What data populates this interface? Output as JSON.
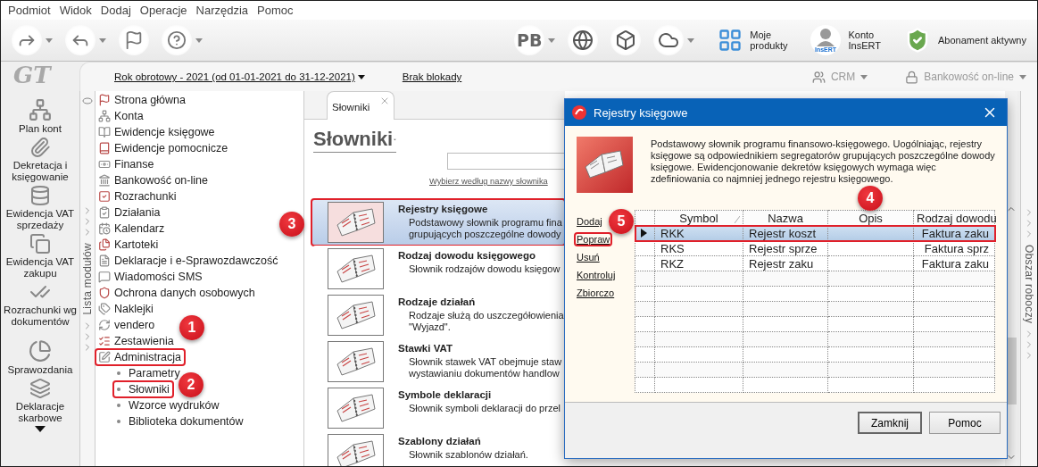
{
  "menu": [
    "Podmiot",
    "Widok",
    "Dodaj",
    "Operacje",
    "Narzędzia",
    "Pomoc"
  ],
  "toolbar": {
    "left_buttons": [
      {
        "kind": "send",
        "dropdown": true
      },
      {
        "kind": "receive",
        "dropdown": true
      },
      {
        "kind": "flag",
        "dropdown": false
      },
      {
        "kind": "help",
        "dropdown": true
      }
    ],
    "right_buttons": [
      {
        "kind": "initials",
        "label": "PB",
        "dropdown": true
      },
      {
        "kind": "globe",
        "dropdown": false
      },
      {
        "kind": "cube",
        "dropdown": false
      },
      {
        "kind": "cloud",
        "dropdown": true
      }
    ],
    "links": [
      {
        "kind": "products",
        "label": "Moje\nprodukty"
      },
      {
        "kind": "account",
        "label": "Konto\nInsERT",
        "icon_text": "InsERT"
      },
      {
        "kind": "subscription",
        "label": "Abonament aktywny"
      }
    ]
  },
  "logo": "GT",
  "shortcuts": [
    "Plan kont",
    "Dekretacja i księgowanie",
    "Ewidencja VAT sprzedaży",
    "Ewidencja VAT zakupu",
    "Rozrachunki wg dokumentów",
    "Sprawozdania",
    "Deklaracje skarbowe"
  ],
  "period_bar": {
    "period": "Rok obrotowy - 2021  (od 01-01-2021 do 31-12-2021)",
    "lock": "Brak blokady",
    "tools": [
      {
        "kind": "crm",
        "label": "CRM"
      },
      {
        "kind": "bank",
        "label": "Bankowość on-line"
      }
    ]
  },
  "modules": {
    "label": "Lista modułów",
    "items": [
      {
        "label": "Strona główna",
        "outlined": false
      },
      {
        "label": "Konta",
        "outlined": false
      },
      {
        "label": "Ewidencje księgowe",
        "outlined": false
      },
      {
        "label": "Ewidencje pomocnicze",
        "outlined": false
      },
      {
        "label": "Finanse",
        "outlined": false
      },
      {
        "label": "Bankowość on-line",
        "outlined": false
      },
      {
        "label": "Rozrachunki",
        "outlined": false
      },
      {
        "label": "Działania",
        "outlined": false
      },
      {
        "label": "Kalendarz",
        "outlined": false
      },
      {
        "label": "Kartoteki",
        "outlined": false
      },
      {
        "label": "Deklaracje i e-Sprawozdawczość",
        "outlined": false
      },
      {
        "label": "Wiadomości SMS",
        "outlined": false
      },
      {
        "label": "Ochrona danych osobowych",
        "outlined": false
      },
      {
        "label": "Naklejki",
        "outlined": false
      },
      {
        "label": "vendero",
        "outlined": false
      },
      {
        "label": "Zestawienia",
        "outlined": false
      },
      {
        "label": "Administracja",
        "outlined": true,
        "children": [
          {
            "label": "Parametry",
            "outlined": false
          },
          {
            "label": "Słowniki",
            "outlined": true
          },
          {
            "label": "Wzorce wydruków",
            "outlined": false
          },
          {
            "label": "Biblioteka dokumentów",
            "outlined": false
          }
        ]
      }
    ]
  },
  "content": {
    "tab": {
      "label": "Słowniki"
    },
    "heading": "Słowniki",
    "filter_link": "Wybierz według nazwy słownika",
    "items": [
      {
        "title": "Rejestry księgowe",
        "description": "Podstawowy słownik programu fina\ngrupujących poszczególne dowody",
        "selected": true,
        "outlined": true
      },
      {
        "title": "Rodzaj dowodu księgowego",
        "description": "Słownik rodzajów dowodu księgow",
        "selected": false,
        "outlined": false
      },
      {
        "title": "Rodzaje działań",
        "description": "Rodzaje służą do uszczegółowienia\n\"Wyjazd\".",
        "selected": false,
        "outlined": false
      },
      {
        "title": "Stawki VAT",
        "description": "Słownik stawek VAT obejmuje staw\nwystawianiu dokumentów handlow",
        "selected": false,
        "outlined": false
      },
      {
        "title": "Symbole deklaracji",
        "description": "Słownik symboli deklaracji do przel",
        "selected": false,
        "outlined": false
      },
      {
        "title": "Szablony działań",
        "description": "Słownik szablonów działań.",
        "selected": false,
        "outlined": false
      }
    ]
  },
  "workspace": {
    "label": "Obszar roboczy"
  },
  "dialog": {
    "title": "Rejestry księgowe",
    "description": "Podstawowy słownik programu finansowo-księgowego. Uogólniając, rejestry księgowe są odpowiednikiem segregatorów grupujących poszczególne dowody księgowe. Ewidencjonowanie dekretów księgowych wymaga więc zdefiniowania co najmniej jednego rejestru księgowego.",
    "actions": [
      {
        "label": "Dodaj",
        "outlined": false
      },
      {
        "label": "Popraw",
        "outlined": true
      },
      {
        "label": "Usuń",
        "outlined": false
      },
      {
        "label": "Kontroluj",
        "outlined": false
      },
      {
        "label": "Zbiorczo",
        "outlined": false
      }
    ],
    "columns": [
      "Symbol",
      "Nazwa",
      "Opis",
      "Rodzaj dowodu"
    ],
    "rows": [
      {
        "symbol": "RKK",
        "name": "Rejestr koszt",
        "document_type": "Faktura zaku",
        "selected": true,
        "outlined": true
      },
      {
        "symbol": "RKS",
        "name": "Rejestr sprze",
        "document_type": "Faktura sprz",
        "selected": false,
        "outlined": false
      },
      {
        "symbol": "RKZ",
        "name": "Rejestr zaku",
        "document_type": "Faktura zaku",
        "selected": false,
        "outlined": false
      }
    ],
    "buttons": [
      {
        "label": "Zamknij",
        "default": true
      },
      {
        "label": "Pomoc",
        "default": false
      }
    ]
  },
  "annotations": [
    "1",
    "2",
    "3",
    "4",
    "5"
  ]
}
